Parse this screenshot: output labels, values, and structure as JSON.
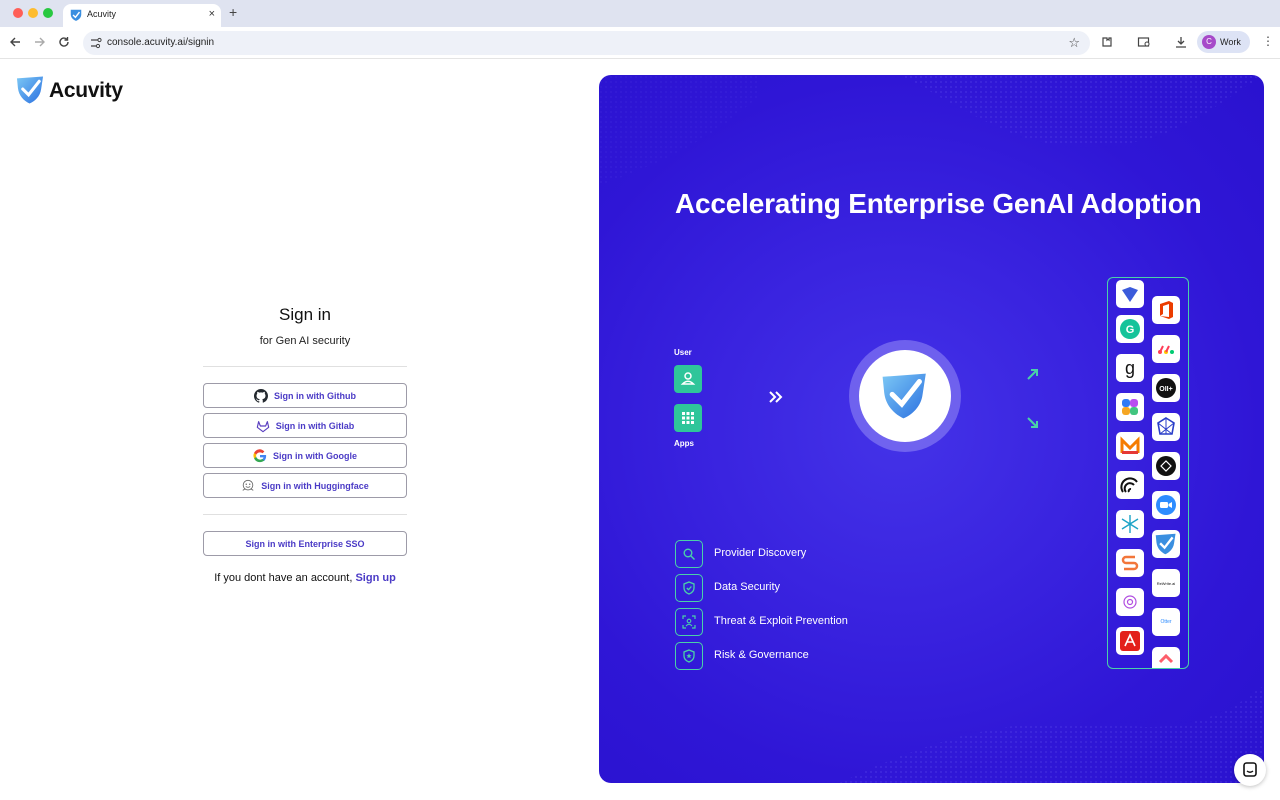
{
  "browser": {
    "tab_title": "Acuvity",
    "new_tab": "+",
    "tab_close": "×",
    "url": "console.acuvity.ai/signin",
    "profile_initial": "C",
    "profile_label": "Work"
  },
  "brand": {
    "name": "Acuvity",
    "accent": "#4b3bc6"
  },
  "signin": {
    "title": "Sign in",
    "subtitle": "for Gen AI security",
    "buttons": {
      "github": "Sign in with Github",
      "gitlab": "Sign in with Gitlab",
      "google": "Sign in with Google",
      "huggingface": "Sign in with Huggingface",
      "sso": "Sign in with Enterprise SSO"
    },
    "signup_prompt": "If you dont have an account,",
    "signup_link": "Sign up"
  },
  "hero": {
    "title": "Accelerating Enterprise GenAI Adoption",
    "user_label": "User",
    "apps_label": "Apps",
    "features": [
      {
        "label": "Provider Discovery",
        "icon": "search-icon"
      },
      {
        "label": "Data Security",
        "icon": "shield-check-icon"
      },
      {
        "label": "Threat & Exploit Prevention",
        "icon": "scan-user-icon"
      },
      {
        "label": "Risk & Governance",
        "icon": "shield-star-icon"
      }
    ],
    "provider_logos_left": [
      "gemini-logo",
      "grammarly-logo",
      "glean-logo",
      "copilot-logo",
      "moveworks-logo",
      "perplexity-logo",
      "cursor-logo",
      "smartling-logo",
      "claude-logo",
      "acrobat-logo"
    ],
    "provider_logos_right": [
      "office-logo",
      "monday-logo",
      "ollama-logo",
      "meta-ai-logo",
      "openai-logo",
      "zoom-logo",
      "acuvity-logo",
      "reword-logo",
      "otter-logo",
      "clickup-logo"
    ],
    "provider_small_texts": {
      "reword": "ReWrite.ai",
      "otter": "Otter"
    },
    "accent_green": "#2fc59a",
    "bg_blue": "#3a24e0"
  }
}
